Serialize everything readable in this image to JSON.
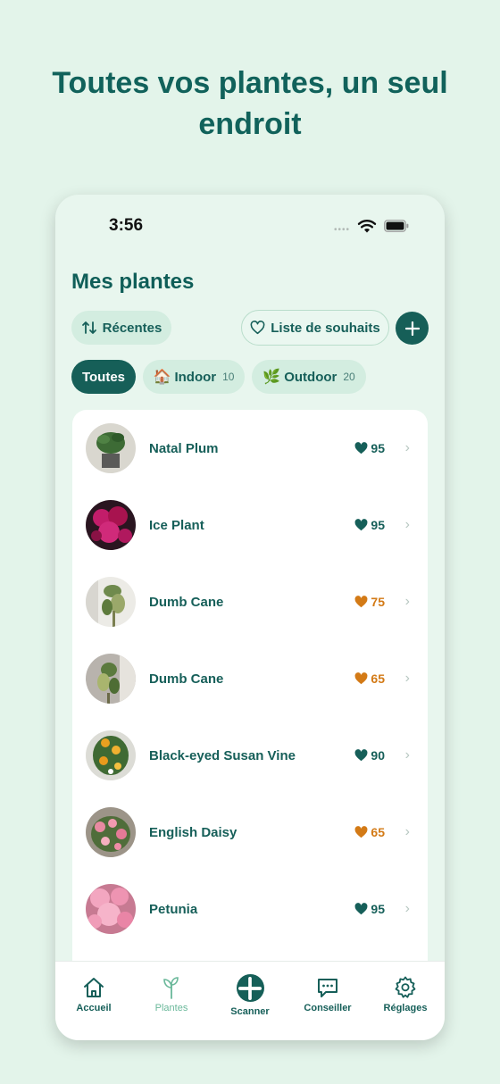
{
  "headline": "Toutes vos plantes, un seul endroit",
  "status": {
    "time": "3:56"
  },
  "page_title": "Mes plantes",
  "sort_label": "Récentes",
  "wishlist_label": "Liste de souhaits",
  "filters": {
    "all": "Toutes",
    "indoor": {
      "label": "Indoor",
      "count": "10",
      "emoji": "🏠"
    },
    "outdoor": {
      "label": "Outdoor",
      "count": "20",
      "emoji": "🌿"
    }
  },
  "plants": [
    {
      "name": "Natal Plum",
      "score": "95",
      "status": "good"
    },
    {
      "name": "Ice Plant",
      "score": "95",
      "status": "good"
    },
    {
      "name": "Dumb Cane",
      "score": "75",
      "status": "ok"
    },
    {
      "name": "Dumb Cane",
      "score": "65",
      "status": "ok"
    },
    {
      "name": "Black-eyed Susan Vine",
      "score": "90",
      "status": "good"
    },
    {
      "name": "English Daisy",
      "score": "65",
      "status": "ok"
    },
    {
      "name": "Petunia",
      "score": "95",
      "status": "good"
    }
  ],
  "tabs": {
    "home": "Accueil",
    "plants": "Plantes",
    "scanner": "Scanner",
    "advise": "Conseiller",
    "settings": "Réglages"
  },
  "colors": {
    "brand": "#165f58",
    "good": "#165f59",
    "warning": "#d37a16",
    "background": "#e3f4ea"
  },
  "icons": [
    "sort-icon",
    "heart-icon",
    "plus-icon",
    "home-icon",
    "sprout-icon",
    "chat-icon",
    "gear-icon",
    "chevron-right-icon"
  ]
}
